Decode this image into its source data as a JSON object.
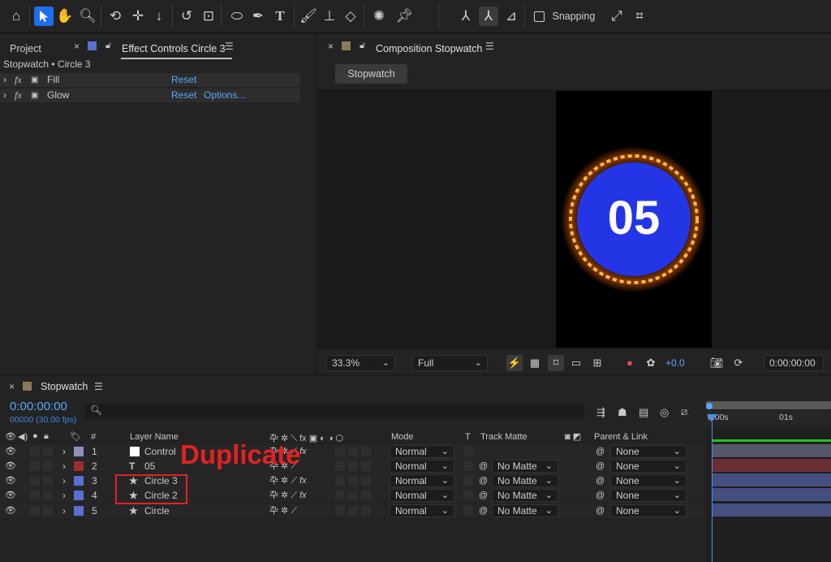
{
  "toolbar": {
    "snapping_label": "Snapping"
  },
  "project_panel": {
    "project_tab": "Project",
    "effect_tab": "Effect Controls Circle 3",
    "breadcrumb": "Stopwatch • Circle 3",
    "effects": [
      {
        "name": "Fill",
        "reset": "Reset",
        "options": ""
      },
      {
        "name": "Glow",
        "reset": "Reset",
        "options": "Options..."
      }
    ]
  },
  "composition": {
    "tab": "Composition Stopwatch",
    "flow_button": "Stopwatch",
    "display_number": "05",
    "zoom": "33.3%",
    "resolution": "Full",
    "exposure": "+0.0",
    "timecode": "0:00:00:00"
  },
  "timeline": {
    "tab": "Stopwatch",
    "current_time": "0:00:00:00",
    "frames_fps": "00000 (30.00 fps)",
    "ruler": {
      "start": "0:00s",
      "mark": "01s"
    },
    "headers": {
      "num": "#",
      "layer_name": "Layer Name",
      "mode": "Mode",
      "t": "T",
      "track_matte": "Track Matte",
      "parent_link": "Parent & Link"
    },
    "layers": [
      {
        "num": "1",
        "name": "Control",
        "icon": "solid",
        "mode": "Normal",
        "matte": "",
        "parent": "None",
        "label": "#8f8fc0"
      },
      {
        "num": "2",
        "name": "05",
        "icon": "text",
        "mode": "Normal",
        "matte": "No Matte",
        "parent": "None",
        "label": "#9b2f2f"
      },
      {
        "num": "3",
        "name": "Circle 3",
        "icon": "star",
        "mode": "Normal",
        "matte": "No Matte",
        "parent": "None",
        "label": "#5a6fd0"
      },
      {
        "num": "4",
        "name": "Circle 2",
        "icon": "star",
        "mode": "Normal",
        "matte": "No Matte",
        "parent": "None",
        "label": "#5a6fd0"
      },
      {
        "num": "5",
        "name": "Circle",
        "icon": "star",
        "mode": "Normal",
        "matte": "No Matte",
        "parent": "None",
        "label": "#5a6fd0"
      }
    ]
  },
  "annotation": {
    "text": "Duplicate"
  },
  "colors": {
    "accent": "#1f6ef0",
    "blue_text": "#5aa7ff",
    "annotation_red": "#e32222",
    "circle_blue": "#2435e6",
    "ring_orange": "#ffb84a"
  }
}
